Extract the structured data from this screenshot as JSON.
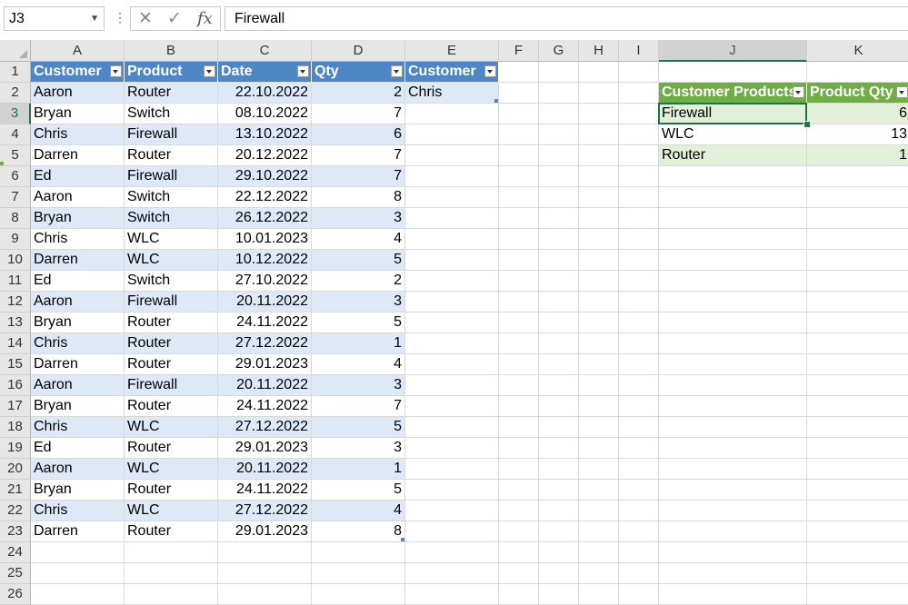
{
  "formula_bar": {
    "name_box": "J3",
    "formula": "Firewall",
    "fx_label": "fx",
    "cancel_icon": "close-icon",
    "enter_icon": "check-icon",
    "more_icon": "vertical-dots-icon"
  },
  "columns": [
    "A",
    "B",
    "C",
    "D",
    "E",
    "F",
    "G",
    "H",
    "I",
    "J",
    "K"
  ],
  "selected_cell": "J3",
  "rows": [
    "1",
    "2",
    "3",
    "4",
    "5",
    "6",
    "7",
    "8",
    "9",
    "10",
    "11",
    "12",
    "13",
    "14",
    "15",
    "16",
    "17",
    "18",
    "19",
    "20",
    "21",
    "22",
    "23",
    "24",
    "25",
    "26"
  ],
  "sales_table": {
    "headers": [
      "Customer",
      "Product",
      "Date",
      "Qty"
    ],
    "rows": [
      [
        "Aaron",
        "Router",
        "22.10.2022",
        "2"
      ],
      [
        "Bryan",
        "Switch",
        "08.10.2022",
        "7"
      ],
      [
        "Chris",
        "Firewall",
        "13.10.2022",
        "6"
      ],
      [
        "Darren",
        "Router",
        "20.12.2022",
        "7"
      ],
      [
        "Ed",
        "Firewall",
        "29.10.2022",
        "7"
      ],
      [
        "Aaron",
        "Switch",
        "22.12.2022",
        "8"
      ],
      [
        "Bryan",
        "Switch",
        "26.12.2022",
        "3"
      ],
      [
        "Chris",
        "WLC",
        "10.01.2023",
        "4"
      ],
      [
        "Darren",
        "WLC",
        "10.12.2022",
        "5"
      ],
      [
        "Ed",
        "Switch",
        "27.10.2022",
        "2"
      ],
      [
        "Aaron",
        "Firewall",
        "20.11.2022",
        "3"
      ],
      [
        "Bryan",
        "Router",
        "24.11.2022",
        "5"
      ],
      [
        "Chris",
        "Router",
        "27.12.2022",
        "1"
      ],
      [
        "Darren",
        "Router",
        "29.01.2023",
        "4"
      ],
      [
        "Aaron",
        "Firewall",
        "20.11.2022",
        "3"
      ],
      [
        "Bryan",
        "Router",
        "24.11.2022",
        "7"
      ],
      [
        "Chris",
        "WLC",
        "27.12.2022",
        "5"
      ],
      [
        "Ed",
        "Router",
        "29.01.2023",
        "3"
      ],
      [
        "Aaron",
        "WLC",
        "20.11.2022",
        "1"
      ],
      [
        "Bryan",
        "Router",
        "24.11.2022",
        "5"
      ],
      [
        "Chris",
        "WLC",
        "27.12.2022",
        "4"
      ],
      [
        "Darren",
        "Router",
        "29.01.2023",
        "8"
      ]
    ]
  },
  "filter_table": {
    "header": "Customer",
    "value": "Chris"
  },
  "result_table": {
    "headers": [
      "Customer Products",
      "Product Qty"
    ],
    "rows": [
      [
        "Firewall",
        "6"
      ],
      [
        "WLC",
        "13"
      ],
      [
        "Router",
        "1"
      ]
    ]
  },
  "colors": {
    "table_blue_header": "#4f86c6",
    "table_blue_band": "#dde9f6",
    "table_green_header": "#70ad47",
    "table_green_band": "#e2efd9",
    "selection": "#217346"
  }
}
